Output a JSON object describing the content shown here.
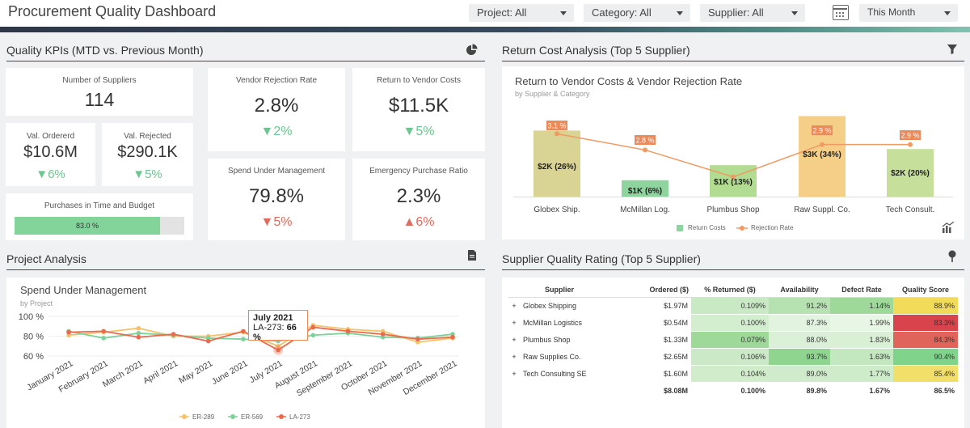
{
  "header": {
    "title": "Procurement Quality Dashboard",
    "filters": {
      "project": "Project: All",
      "category": "Category: All",
      "supplier": "Supplier: All",
      "period": "This Month"
    }
  },
  "kpi_section": {
    "title": "Quality KPIs (MTD vs. Previous Month)",
    "cards": {
      "suppliers": {
        "label": "Number of Suppliers",
        "value": "114"
      },
      "ordered": {
        "label": "Val. Ordererd",
        "value": "$10.6M",
        "delta": "6%"
      },
      "rejected": {
        "label": "Val. Rejected",
        "value": "$290.1K",
        "delta": "5%"
      },
      "purchases": {
        "label": "Purchases in Time and Budget",
        "value_text": "83.0 %",
        "fraction": 0.83
      },
      "vendor_rejection": {
        "label": "Vendor Rejection Rate",
        "value": "2.8%",
        "delta": "2%"
      },
      "rtv_costs": {
        "label": "Return to Vendor Costs",
        "value": "$11.5K",
        "delta": "5%"
      },
      "spend_mgmt": {
        "label": "Spend Under Management",
        "value": "79.8%",
        "delta": "5%"
      },
      "emergency": {
        "label": "Emergency Purchase Ratio",
        "value": "2.3%",
        "delta": "6%"
      }
    },
    "colors": {
      "up": "#6dc58f",
      "down": "#e06c5e"
    }
  },
  "return_cost": {
    "section_title": "Return Cost Analysis (Top 5 Supplier)",
    "chart_title": "Return to Vendor Costs & Vendor Rejection Rate",
    "chart_subtitle": "by Supplier & Category",
    "legend": {
      "bar": "Return Costs",
      "line": "Rejection Rate"
    }
  },
  "project_analysis": {
    "section_title": "Project Analysis",
    "chart_title": "Spend Under Management",
    "chart_subtitle": "by Project",
    "tooltip": {
      "title": "July 2021",
      "series": "LA-273:",
      "value": "66 %"
    }
  },
  "supplier_quality": {
    "section_title": "Supplier Quality Rating (Top 5 Supplier)",
    "columns": [
      "Supplier",
      "Ordered ($)",
      "% Returned ($)",
      "Availability",
      "Defect Rate",
      "Quality Score"
    ],
    "rows": [
      {
        "expand": "+",
        "supplier": "Globex Shipping",
        "ordered": "$1.97M",
        "returned": "0.109%",
        "availability": "91.2%",
        "defect": "1.14%",
        "score": "88.9%"
      },
      {
        "expand": "+",
        "supplier": "McMillan Logistics",
        "ordered": "$0.54M",
        "returned": "0.100%",
        "availability": "87.3%",
        "defect": "1.99%",
        "score": "83.3%"
      },
      {
        "expand": "+",
        "supplier": "Plumbus Shop",
        "ordered": "$1.33M",
        "returned": "0.079%",
        "availability": "88.0%",
        "defect": "1.83%",
        "score": "84.3%"
      },
      {
        "expand": "+",
        "supplier": "Raw Supplies Co.",
        "ordered": "$2.65M",
        "returned": "0.106%",
        "availability": "93.7%",
        "defect": "1.63%",
        "score": "90.4%"
      },
      {
        "expand": "+",
        "supplier": "Tech Consulting SE",
        "ordered": "$1.60M",
        "returned": "0.104%",
        "availability": "89.0%",
        "defect": "1.77%",
        "score": "85.4%"
      }
    ],
    "total": {
      "ordered": "$8.08M",
      "returned": "0.100%",
      "availability": "89.8%",
      "defect": "1.67%",
      "score": "86.5%"
    },
    "cell_colors": {
      "returned": [
        "#c9e9c5",
        "#d3edcf",
        "#9ed99a",
        "#cbe9c6",
        "#d0ecca"
      ],
      "availability": [
        "#b6e2b2",
        "#e2f3df",
        "#daf0d7",
        "#8fd48f",
        "#cfebcb"
      ],
      "defect": [
        "#9ed99a",
        "#e8f6e5",
        "#d9f0d5",
        "#c3e7bf",
        "#cfecca"
      ],
      "score": [
        "#f3db5a",
        "#d9434b",
        "#e0645a",
        "#7fd38b",
        "#f1df6a"
      ]
    }
  },
  "chart_data": [
    {
      "type": "bar",
      "title": "Return to Vendor Costs & Vendor Rejection Rate",
      "subtitle": "by Supplier & Category",
      "categories": [
        "Globex Ship.",
        "McMillan Log.",
        "Plumbus Shop",
        "Raw Suppl. Co.",
        "Tech Consult."
      ],
      "series": [
        {
          "name": "Return Costs",
          "kind": "bar",
          "values": [
            2,
            1,
            1,
            3,
            2
          ],
          "labels": [
            "$2K (26%)",
            "$1K (6%)",
            "$1K (13%)",
            "$3K (34%)",
            "$2K (20%)"
          ],
          "colors": [
            "#d9d394",
            "#8ed49f",
            "#b1dc92",
            "#f5cf88",
            "#c6df9a"
          ]
        },
        {
          "name": "Rejection Rate",
          "kind": "line",
          "values": [
            3.1,
            2.8,
            2.3,
            2.9,
            2.9
          ],
          "labels": [
            "3.1 %",
            "2.8 %",
            "2.3 %",
            "2.9 %",
            "2.9 %"
          ],
          "color": "#f09a64"
        }
      ],
      "ylim_bar": [
        0,
        3.4
      ],
      "ylim_line": [
        2.1,
        3.3
      ],
      "legend": "bottom"
    },
    {
      "type": "line",
      "title": "Spend Under Management",
      "subtitle": "by Project",
      "categories": [
        "January 2021",
        "February 2021",
        "March 2021",
        "April 2021",
        "May 2021",
        "June 2021",
        "July 2021",
        "August 2021",
        "September 2021",
        "October 2021",
        "November 2021",
        "December 2021"
      ],
      "yticks": [
        "100 %",
        "80 %",
        "60 %"
      ],
      "ylim": [
        60,
        100
      ],
      "series": [
        {
          "name": "ER-289",
          "color": "#f5c26b",
          "values": [
            81,
            84,
            88,
            80,
            80,
            84,
            70,
            91,
            87,
            85,
            74,
            78
          ]
        },
        {
          "name": "ER-569",
          "color": "#7ed19a",
          "values": [
            85,
            78,
            83,
            81,
            78,
            77,
            75,
            81,
            83,
            79,
            78,
            82
          ]
        },
        {
          "name": "LA-273",
          "color": "#ec6a4c",
          "values": [
            84,
            85,
            79,
            82,
            75,
            85,
            66,
            89,
            85,
            82,
            77,
            79
          ]
        }
      ],
      "legend": "bottom",
      "highlight": {
        "category": "July 2021",
        "series": "LA-273",
        "value": 66
      }
    }
  ]
}
